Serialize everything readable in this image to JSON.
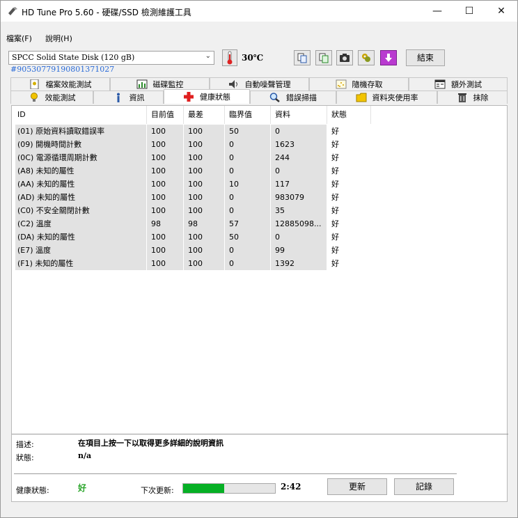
{
  "window": {
    "title": "HD Tune Pro 5.60 - 硬碟/SSD 檢測維護工具",
    "minimize": "—",
    "maximize": "☐",
    "close": "✕"
  },
  "menu": [
    {
      "label": "檔案(F)"
    },
    {
      "label": "說明(H)"
    }
  ],
  "toolbar": {
    "drive": "SPCC Solid State Disk (120 gB)",
    "serial": "#905307791908013710​27",
    "temperature": "30℃",
    "exit_label": "結束",
    "icons": [
      "thermometer-icon",
      "copy-icon",
      "copy-all-icon",
      "camera-icon",
      "options-icon",
      "download-icon"
    ]
  },
  "tabs": {
    "row1": [
      "檔案效能測試",
      "磁碟監控",
      "自動噪聲管理",
      "隨機存取",
      "額外測試"
    ],
    "row2": [
      "效能測試",
      "資訊",
      "健康狀態",
      "錯誤掃描",
      "資料夾使用率",
      "抹除"
    ],
    "active": "健康狀態"
  },
  "table": {
    "columns": [
      "ID",
      "目前值",
      "最差",
      "臨界值",
      "資料",
      "狀態"
    ],
    "rows": [
      [
        "(01) 原始資料讀取錯誤率",
        "100",
        "100",
        "50",
        "0",
        "好"
      ],
      [
        "(09) 開機時間計數",
        "100",
        "100",
        "0",
        "1623",
        "好"
      ],
      [
        "(0C) 電源循環周期計數",
        "100",
        "100",
        "0",
        "244",
        "好"
      ],
      [
        "(A8) 未知的屬性",
        "100",
        "100",
        "0",
        "0",
        "好"
      ],
      [
        "(AA) 未知的屬性",
        "100",
        "100",
        "10",
        "117",
        "好"
      ],
      [
        "(AD) 未知的屬性",
        "100",
        "100",
        "0",
        "983079",
        "好"
      ],
      [
        "(C0) 不安全關閉計數",
        "100",
        "100",
        "0",
        "35",
        "好"
      ],
      [
        "(C2) 溫度",
        "98",
        "98",
        "57",
        "12885098...",
        "好"
      ],
      [
        "(DA) 未知的屬性",
        "100",
        "100",
        "50",
        "0",
        "好"
      ],
      [
        "(E7) 溫度",
        "100",
        "100",
        "0",
        "99",
        "好"
      ],
      [
        "(F1) 未知的屬性",
        "100",
        "100",
        "0",
        "1392",
        "好"
      ]
    ]
  },
  "details": {
    "desc_label": "描述:",
    "desc_value": "在項目上按一下以取得更多詳細的說明資訊",
    "status_label": "狀態:",
    "status_value": "n/a"
  },
  "footer": {
    "health_label": "健康狀態:",
    "health_value": "好",
    "next_update_label": "下次更新:",
    "progress_percent": 45,
    "countdown": "2:42",
    "update_button": "更新",
    "log_button": "記錄"
  },
  "colors": {
    "status_good": "#28a428",
    "progress_fill": "#06b025",
    "serial_link": "#2a6bd8"
  }
}
